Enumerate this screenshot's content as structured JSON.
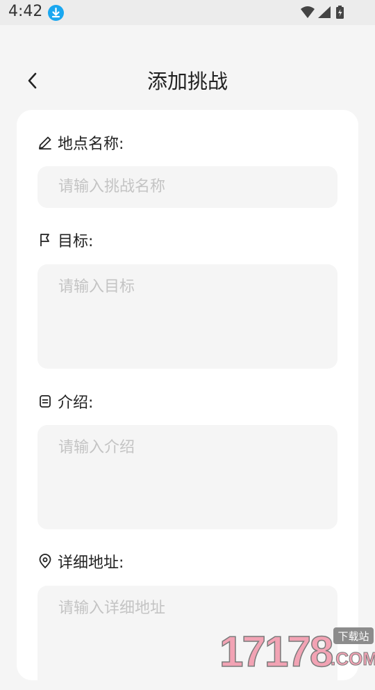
{
  "status_bar": {
    "time": "4:42",
    "icons": [
      "download-icon",
      "wifi-icon",
      "signal-icon",
      "battery-icon"
    ],
    "download_badge_color": "#1aa7f0"
  },
  "header": {
    "title": "添加挑战",
    "back_icon": "chevron-left-icon"
  },
  "form": {
    "fields": [
      {
        "label": "地点名称:",
        "icon": "pencil-icon",
        "placeholder": "请输入挑战名称",
        "type": "single-line"
      },
      {
        "label": "目标:",
        "icon": "flag-icon",
        "placeholder": "请输入目标",
        "type": "multi-line"
      },
      {
        "label": "介绍:",
        "icon": "note-icon",
        "placeholder": "请输入介绍",
        "type": "multi-line"
      },
      {
        "label": "详细地址:",
        "icon": "location-pin-icon",
        "placeholder": "请输入详细地址",
        "type": "multi-line"
      }
    ]
  },
  "watermark": {
    "number": "17178",
    "domain": ".COM",
    "tag": "下载站"
  },
  "colors": {
    "page_bg": "#f5f5f5",
    "card_bg": "#ffffff",
    "input_bg": "#f5f5f5",
    "placeholder": "#c4c4c4",
    "text": "#222222",
    "watermark_pink": "#f2a3b4",
    "watermark_gray": "#8c8c8c"
  }
}
